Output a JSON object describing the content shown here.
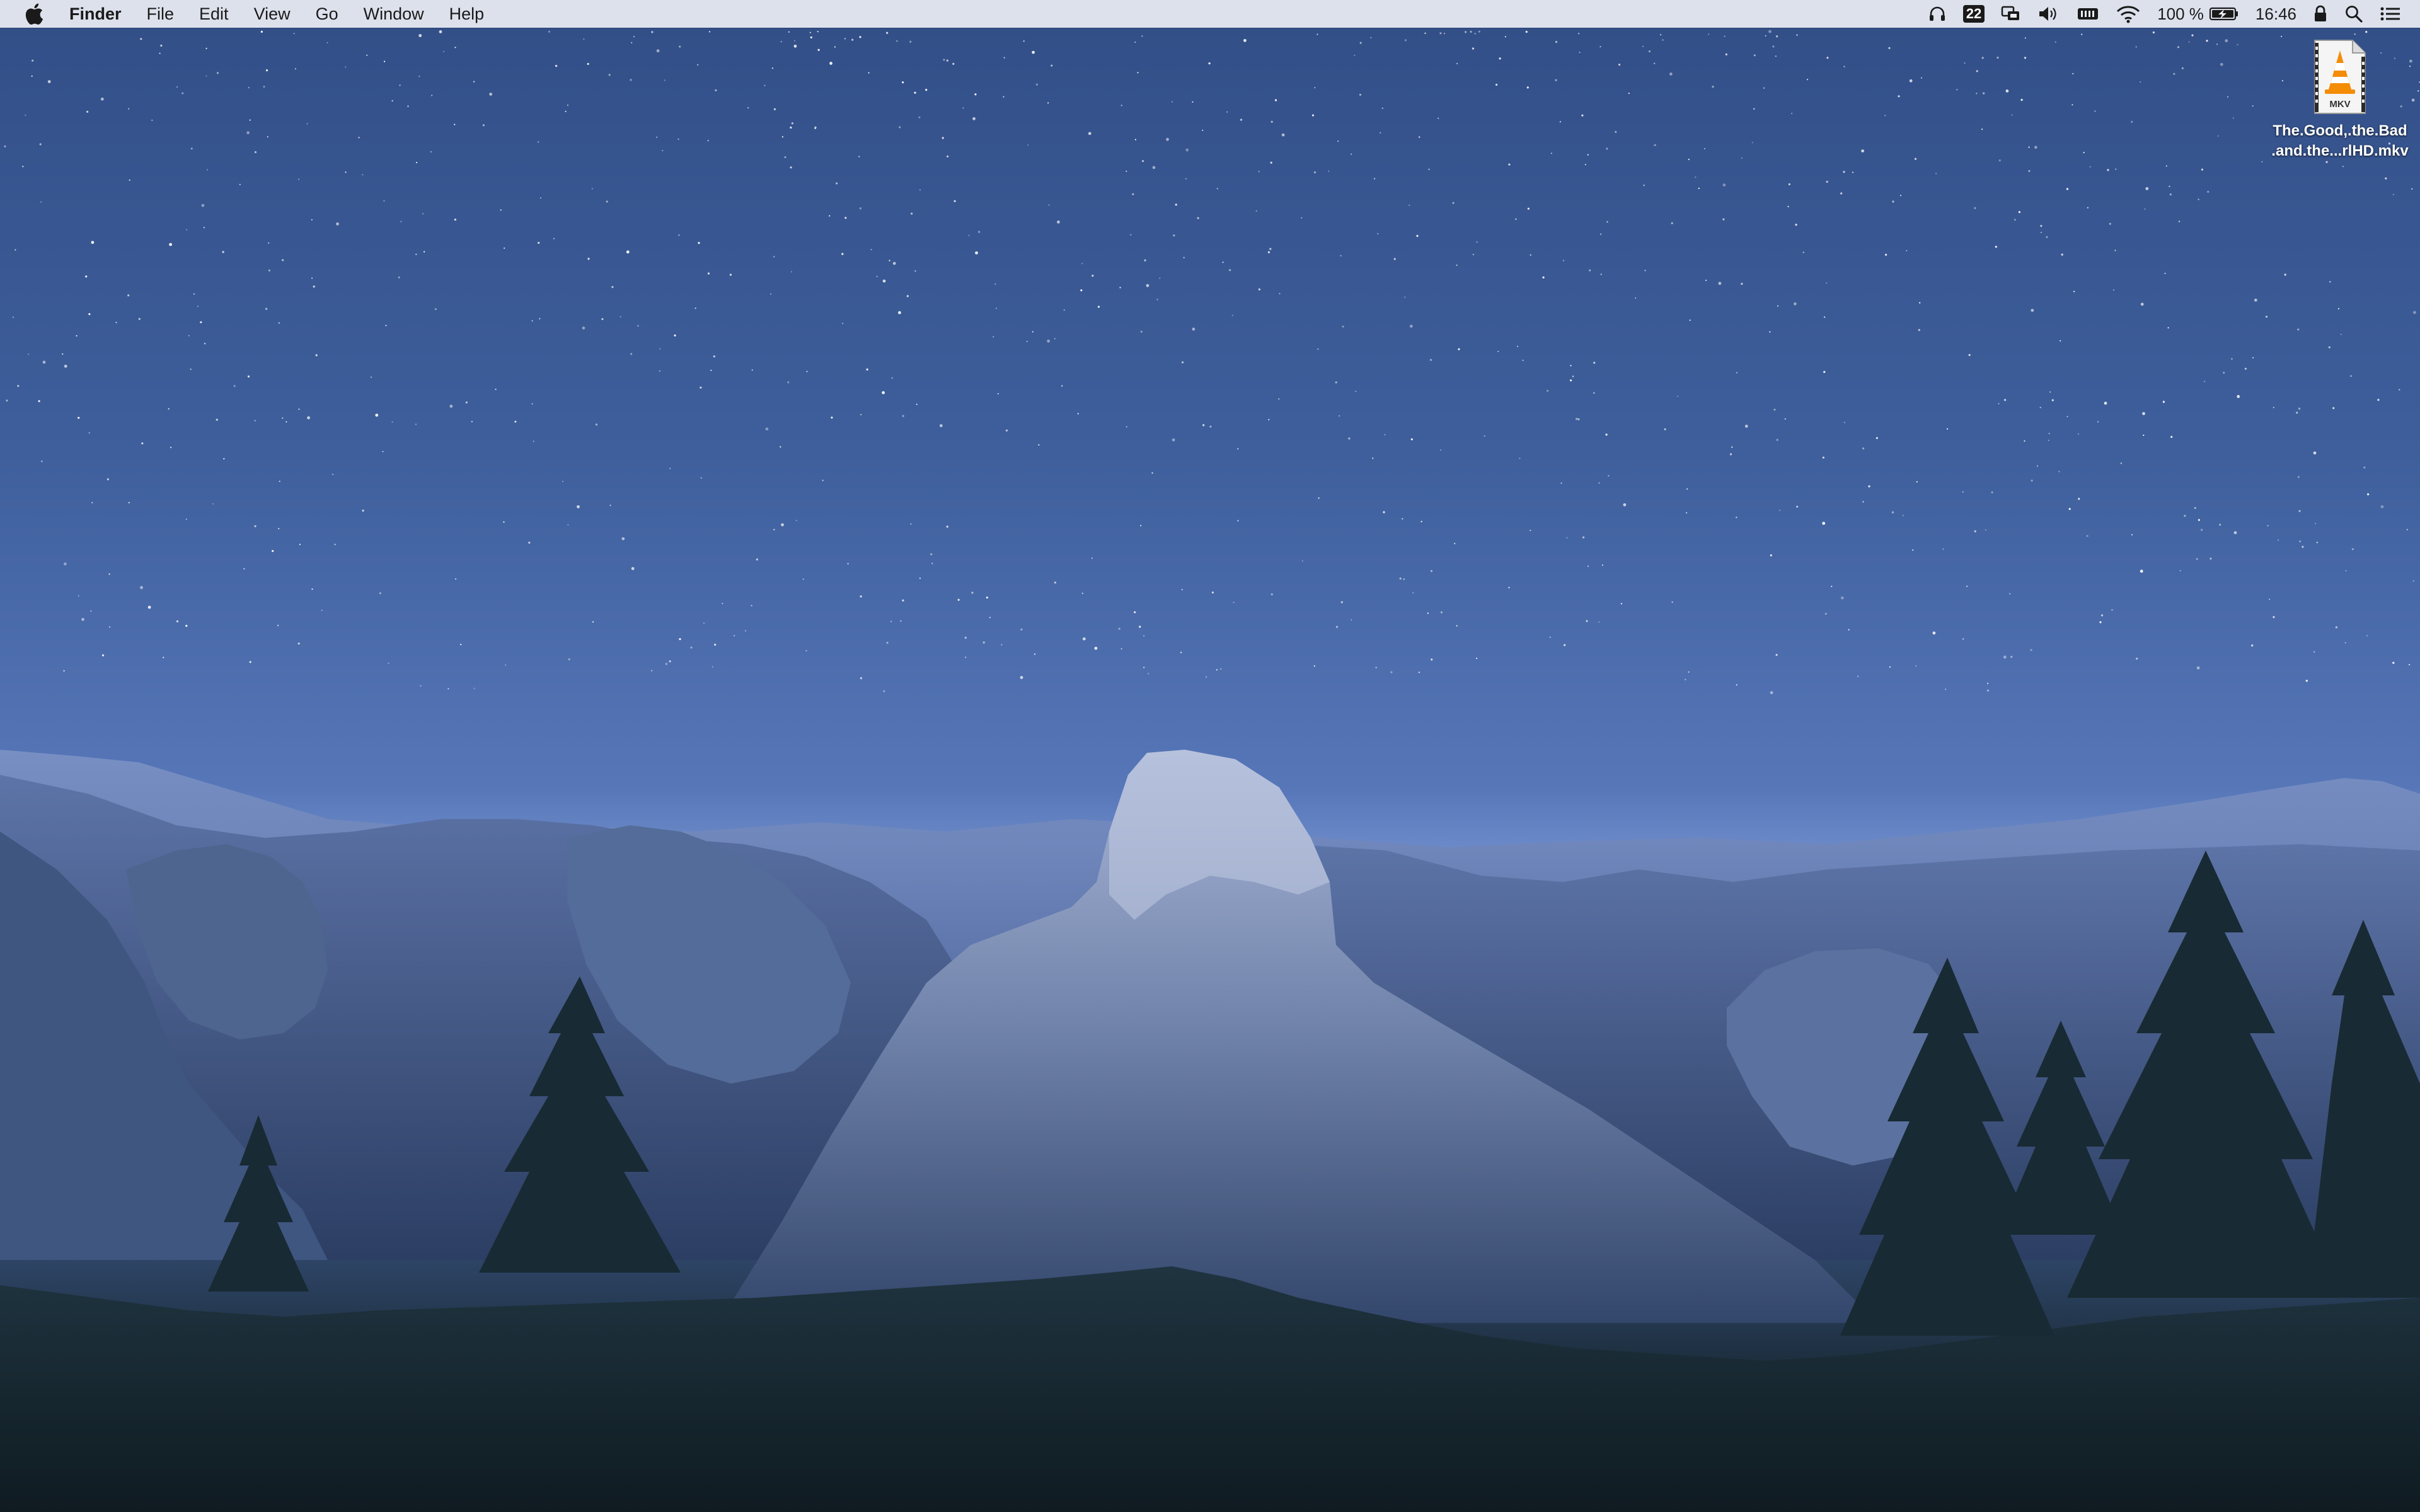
{
  "menubar": {
    "apple_icon": "apple-logo-icon",
    "app_name": "Finder",
    "menus": [
      "File",
      "Edit",
      "View",
      "Go",
      "Window",
      "Help"
    ],
    "status": {
      "calendar_day": "22",
      "battery_percent": "100 %",
      "time": "16:46"
    }
  },
  "desktop": {
    "file": {
      "label_line1": "The.Good,.the.Bad",
      "label_line2": ".and.the...rlHD.mkv",
      "badge": "MKV",
      "icon": "vlc-cone-icon"
    }
  },
  "colors": {
    "menubar_bg": "#eceef4",
    "sky_top": "#324e87",
    "sky_horizon": "#6b89c8",
    "vlc_orange": "#f48c06"
  }
}
